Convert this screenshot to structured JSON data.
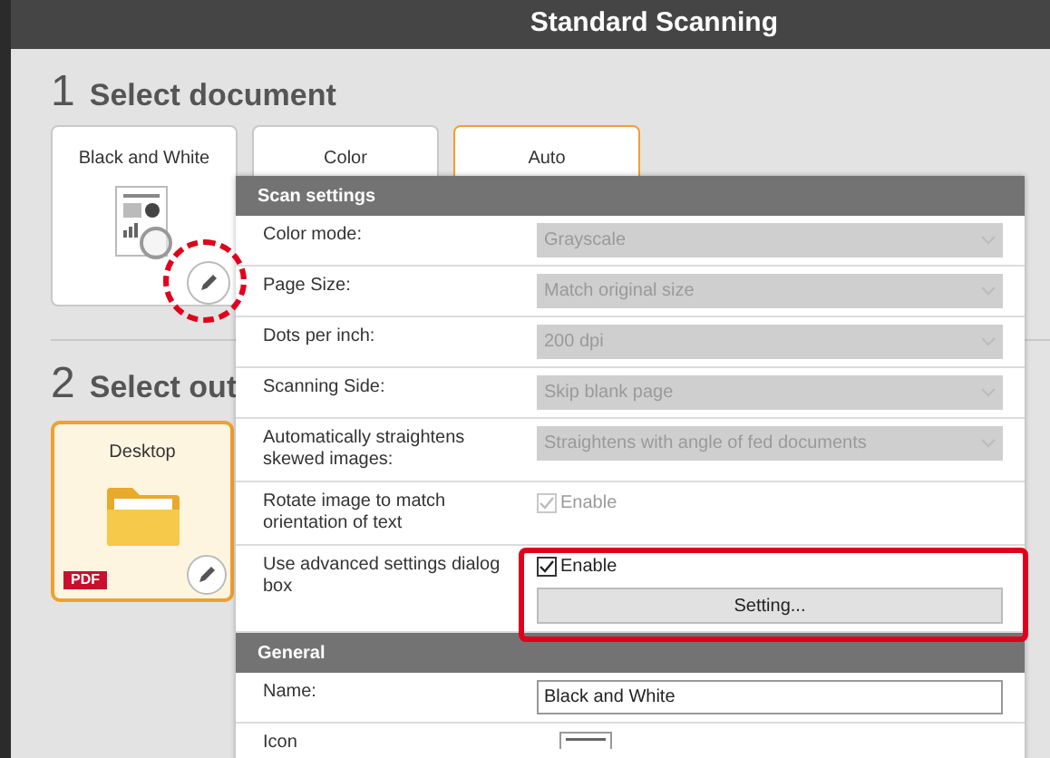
{
  "window": {
    "title": "Standard Scanning"
  },
  "steps": [
    {
      "number": "1",
      "title": "Select document"
    },
    {
      "number": "2",
      "title": "Select out"
    }
  ],
  "documents": [
    {
      "label": "Black and White",
      "selected": false
    },
    {
      "label": "Color",
      "selected": false
    },
    {
      "label": "Auto",
      "selected": true
    }
  ],
  "outputs": [
    {
      "label": "Desktop",
      "badge": "PDF",
      "selected": true
    }
  ],
  "dialog": {
    "sections": [
      {
        "title": "Scan settings",
        "rows": [
          {
            "kind": "select",
            "label": "Color mode:",
            "value": "Grayscale",
            "disabled": true
          },
          {
            "kind": "select",
            "label": "Page Size:",
            "value": "Match original size",
            "disabled": true
          },
          {
            "kind": "select",
            "label": "Dots per inch:",
            "value": "200 dpi",
            "disabled": true
          },
          {
            "kind": "select",
            "label": "Scanning Side:",
            "value": "Skip blank page",
            "disabled": true
          },
          {
            "kind": "select",
            "label": "Automatically straightens skewed images:",
            "value": "Straightens with angle of fed documents",
            "disabled": true
          },
          {
            "kind": "checkbox",
            "label": "Rotate image to match orientation of text",
            "option": "Enable",
            "checked": true,
            "disabled": true
          },
          {
            "kind": "checkbox",
            "label": "Use advanced settings dialog box",
            "option": "Enable",
            "checked": true,
            "disabled": false,
            "button": "Setting...",
            "highlighted": true
          }
        ]
      },
      {
        "title": "General",
        "rows": [
          {
            "kind": "text",
            "label": "Name:",
            "value": "Black and White"
          },
          {
            "kind": "icon",
            "label": "Icon"
          }
        ]
      }
    ]
  }
}
